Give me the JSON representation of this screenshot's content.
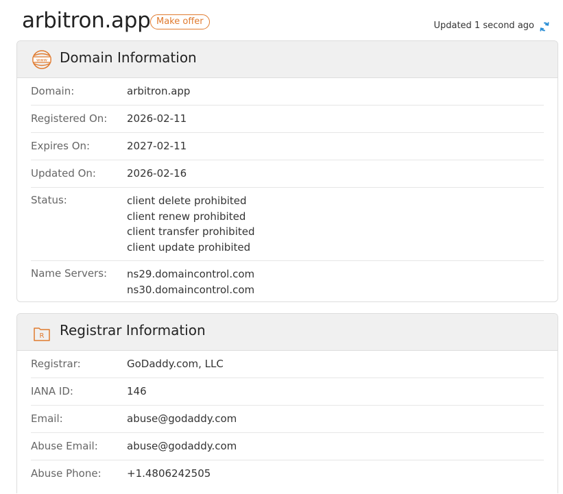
{
  "header": {
    "domain": "arbitron.app",
    "offer_label": "Make offer",
    "updated_text": "Updated 1 second ago"
  },
  "domain_info": {
    "title": "Domain Information",
    "icon": "www-globe-icon",
    "rows": {
      "domain": {
        "label": "Domain:",
        "value": "arbitron.app"
      },
      "registered": {
        "label": "Registered On:",
        "value": "2026-02-11"
      },
      "expires": {
        "label": "Expires On:",
        "value": "2027-02-11"
      },
      "updated": {
        "label": "Updated On:",
        "value": "2026-02-16"
      },
      "status": {
        "label": "Status:",
        "values": [
          "client delete prohibited",
          "client renew prohibited",
          "client transfer prohibited",
          "client update prohibited"
        ]
      },
      "nameservers": {
        "label": "Name Servers:",
        "values": [
          "ns29.domaincontrol.com",
          "ns30.domaincontrol.com"
        ]
      }
    }
  },
  "registrar_info": {
    "title": "Registrar Information",
    "icon": "registrar-folder-icon",
    "rows": {
      "registrar": {
        "label": "Registrar:",
        "value": "GoDaddy.com, LLC"
      },
      "iana": {
        "label": "IANA ID:",
        "value": "146"
      },
      "email": {
        "label": "Email:",
        "value": "abuse@godaddy.com"
      },
      "abuse_email": {
        "label": "Abuse Email:",
        "value": "abuse@godaddy.com"
      },
      "abuse_phone": {
        "label": "Abuse Phone:",
        "value": "+1.4806242505"
      }
    }
  },
  "colors": {
    "accent": "#e07a2e",
    "refresh": "#2b8fd6"
  }
}
